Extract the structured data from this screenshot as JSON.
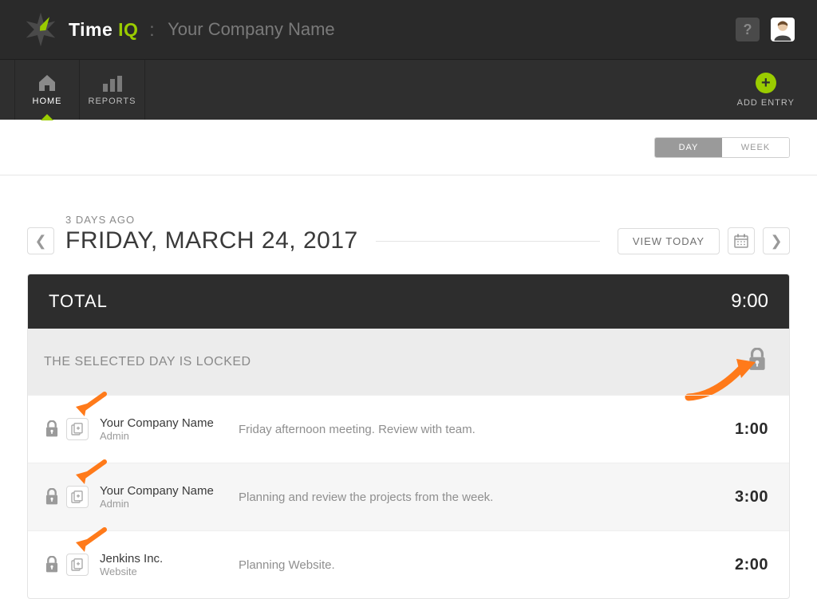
{
  "brand": {
    "name_a": "Time",
    "name_b": "IQ",
    "company": "Your Company Name"
  },
  "nav": {
    "home": "HOME",
    "reports": "REPORTS",
    "add": "ADD ENTRY"
  },
  "toggle": {
    "day": "DAY",
    "week": "WEEK"
  },
  "date": {
    "relative": "3 DAYS AGO",
    "full": "FRIDAY, MARCH 24, 2017",
    "view_today": "VIEW TODAY"
  },
  "summary": {
    "total_label": "TOTAL",
    "total_value": "9:00",
    "locked_msg": "THE SELECTED DAY IS LOCKED"
  },
  "entries": [
    {
      "company": "Your Company Name",
      "role": "Admin",
      "desc": "Friday afternoon meeting. Review with team.",
      "time": "1:00"
    },
    {
      "company": "Your Company Name",
      "role": "Admin",
      "desc": "Planning and review the projects from the week.",
      "time": "3:00"
    },
    {
      "company": "Jenkins Inc.",
      "role": "Website",
      "desc": "Planning Website.",
      "time": "2:00"
    }
  ],
  "colors": {
    "accent": "#9acc00",
    "arrow": "#ff7a1a"
  }
}
